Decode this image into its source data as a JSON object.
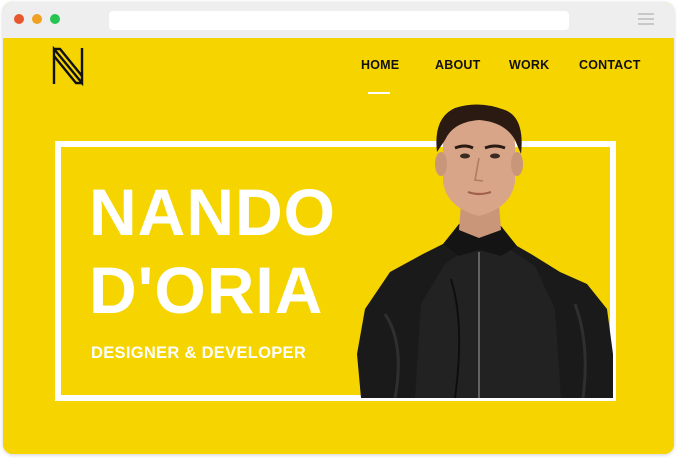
{
  "browser": {
    "url": "",
    "controls": [
      "close-dot",
      "minimize-dot",
      "maximize-dot"
    ]
  },
  "brand": {
    "logo_letter": "N",
    "accent": "#f5d400",
    "text_color": "#ffffff"
  },
  "nav": {
    "items": [
      {
        "label": "HOME",
        "active": true
      },
      {
        "label": "ABOUT",
        "active": false
      },
      {
        "label": "WORK",
        "active": false
      },
      {
        "label": "CONTACT",
        "active": false
      }
    ]
  },
  "hero": {
    "line1": "NANDO",
    "line2": "D'ORIA",
    "subtitle": "DESIGNER & DEVELOPER",
    "image": "portrait-photo"
  }
}
